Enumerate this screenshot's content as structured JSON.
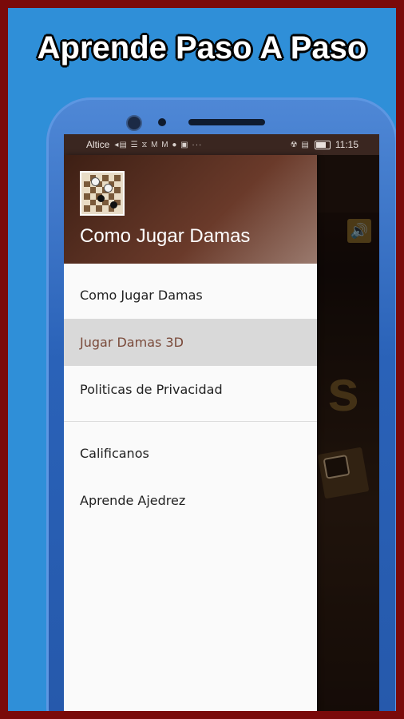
{
  "headline": "Aprende Paso A Paso",
  "statusbar": {
    "carrier": "Altice",
    "left_icons": "◂▤ ☰ ⧖ M M ● ▣ ···",
    "right_icons": "☢ ▤",
    "time": "11:15"
  },
  "drawer": {
    "title": "Como Jugar Damas",
    "items": [
      {
        "label": "Como Jugar Damas"
      },
      {
        "label": "Jugar Damas 3D"
      },
      {
        "label": "Politicas de Privacidad"
      },
      {
        "label": "Calificanos"
      },
      {
        "label": "Aprende Ajedrez"
      }
    ]
  },
  "background_app": {
    "big_text_fragment": "s"
  },
  "colors": {
    "frame": "#7a0a0a",
    "backdrop": "#2f8fd8",
    "drawer_header": "#6a3a2a",
    "active_item_text": "#7a4a3a"
  }
}
